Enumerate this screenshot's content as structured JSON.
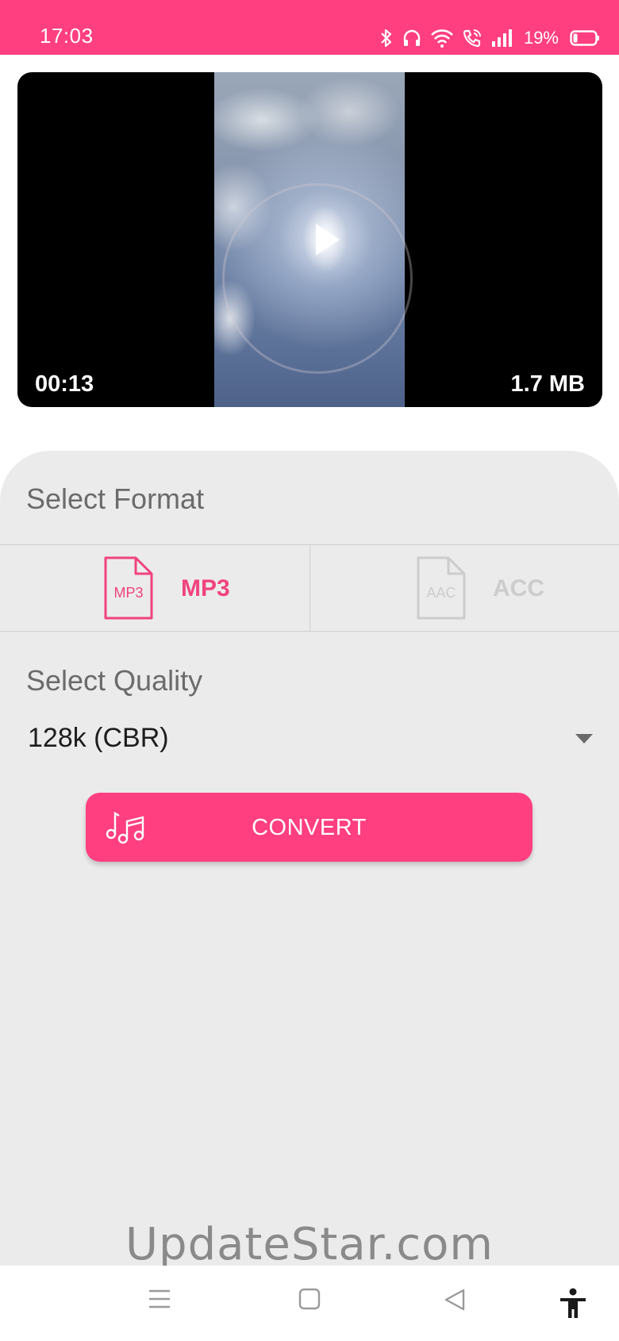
{
  "status_bar": {
    "time": "17:03",
    "battery_percent": "19%",
    "icons": [
      "bluetooth-icon",
      "headset-icon",
      "wifi-icon",
      "wifi-call-icon",
      "signal-icon",
      "battery-icon"
    ]
  },
  "video": {
    "duration": "00:13",
    "size": "1.7 MB"
  },
  "format_section": {
    "title": "Select Format",
    "options": [
      {
        "label": "MP3",
        "icon_text": "MP3",
        "selected": true
      },
      {
        "label": "ACC",
        "icon_text": "AAC",
        "selected": false
      }
    ]
  },
  "quality_section": {
    "title": "Select Quality",
    "selected": "128k (CBR)"
  },
  "convert_button": {
    "label": "CONVERT"
  },
  "watermark": "UpdateStar.com",
  "colors": {
    "accent": "#ff3f7f",
    "panel_bg": "#ebebeb",
    "selected_format": "#f0437f",
    "disabled_format": "#cccccc"
  }
}
